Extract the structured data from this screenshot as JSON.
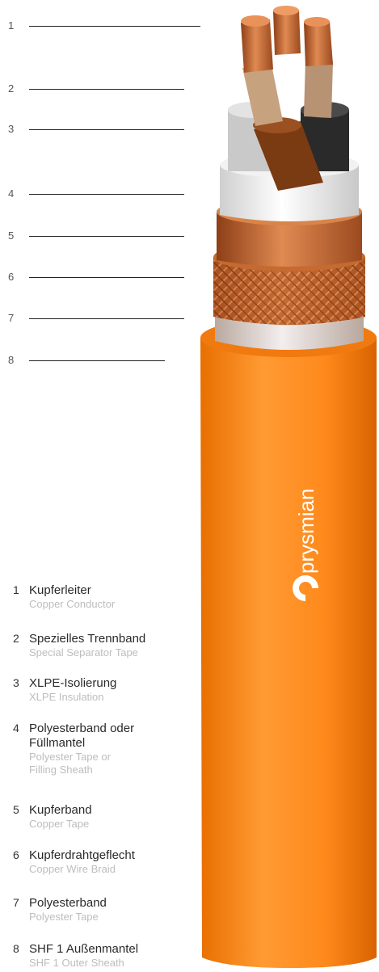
{
  "brand": "prysmian",
  "colors": {
    "sheath": "#ff8a1c",
    "copper": "#c8652a",
    "text": "#2a2a2a",
    "subtext": "#bdbdbd"
  },
  "callouts": [
    "1",
    "2",
    "3",
    "4",
    "5",
    "6",
    "7",
    "8"
  ],
  "legend": [
    {
      "num": "1",
      "de": "Kupferleiter",
      "en": "Copper Conductor"
    },
    {
      "num": "2",
      "de": "Spezielles Trennband",
      "en": "Special Separator Tape"
    },
    {
      "num": "3",
      "de": "XLPE-Isolierung",
      "en": "XLPE Insulation"
    },
    {
      "num": "4",
      "de": "Polyesterband oder Füllmantel",
      "en": "Polyester Tape or Filling Sheath"
    },
    {
      "num": "5",
      "de": "Kupferband",
      "en": "Copper Tape"
    },
    {
      "num": "6",
      "de": "Kupferdrahtgeflecht",
      "en": "Copper Wire Braid"
    },
    {
      "num": "7",
      "de": "Polyesterband",
      "en": "Polyester Tape"
    },
    {
      "num": "8",
      "de": "SHF 1 Außenmantel",
      "en": "SHF 1 Outer Sheath"
    }
  ]
}
